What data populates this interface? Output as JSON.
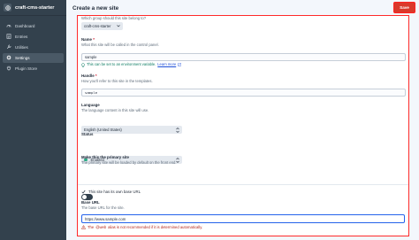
{
  "sidebar": {
    "site_name": "craft-cms-starter",
    "items": [
      {
        "label": "Dashboard",
        "icon": "gauge-icon"
      },
      {
        "label": "Entries",
        "icon": "entries-icon"
      },
      {
        "label": "Utilities",
        "icon": "tool-icon"
      },
      {
        "label": "Settings",
        "icon": "gear-icon",
        "active": true
      },
      {
        "label": "Plugin Store",
        "icon": "plug-icon"
      }
    ]
  },
  "header": {
    "title": "Create a new site",
    "save_label": "Save"
  },
  "form": {
    "group": {
      "instructions": "Which group should this site belong to?",
      "value": "craft-cms-starter"
    },
    "name": {
      "label": "Name",
      "instructions": "What this site will be called in the control panel.",
      "value": "sample",
      "tip": "This can be set to an environment variable.",
      "learn_more": "Learn more"
    },
    "handle": {
      "label": "Handle",
      "instructions": "How you'll refer to this site in the templates.",
      "value": "sample"
    },
    "language": {
      "label": "Language",
      "instructions": "The language content in this site will use.",
      "value": "English (United States)"
    },
    "status": {
      "label": "Status",
      "value": "Enabled"
    },
    "primary": {
      "label": "Make this the primary site",
      "instructions": "The primary site will be loaded by default on the front end.",
      "enabled": true
    },
    "has_urls": {
      "label": "This site has its own base URL",
      "checked": true
    },
    "base_url": {
      "label": "Base URL",
      "instructions": "The base URL for the site.",
      "value": "https://www.sample.com",
      "warning_prefix": "The",
      "warning_code": "@web",
      "warning_suffix": "alias is not recommended if it is determined automatically."
    }
  },
  "colors": {
    "sidebar_bg": "#33414d",
    "save_button": "#d9392b",
    "highlight_border": "#ff2a2a",
    "focus_border": "#2563eb",
    "status_enabled": "#27ab83"
  }
}
